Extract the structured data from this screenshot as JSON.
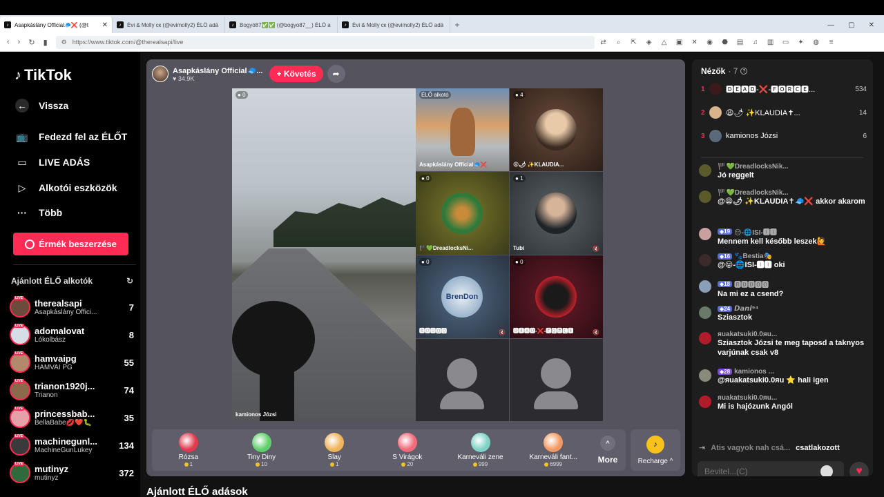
{
  "browser": {
    "tabs": [
      {
        "title": "Asapkáslány Official🧢❌ (@t"
      },
      {
        "title": "Évi & Molly ск (@evimolly2) ÉLŐ adá"
      },
      {
        "title": "Bogyó87✅✅ (@bogyo87__) ÉLŐ a"
      },
      {
        "title": "Évi & Molly ск (@evimolly2) ÉLŐ adá"
      }
    ],
    "url": "https://www.tiktok.com/@therealsapi/live"
  },
  "sidebar": {
    "logo": "TikTok",
    "back": "Vissza",
    "nav": [
      "Fedezd fel az ÉLŐT",
      "LIVE ADÁS",
      "Alkotói eszközök",
      "Több"
    ],
    "coins_button": "Érmék beszerzése",
    "recommended_title": "Ajánlott ÉLŐ alkotók",
    "live_tag": "LIVE",
    "recommended": [
      {
        "name": "therealsapi",
        "sub": "Asapkáslány Offici...",
        "count": "7"
      },
      {
        "name": "adomalovat",
        "sub": "Lókolbász",
        "count": "8"
      },
      {
        "name": "hamvaipg",
        "sub": "HAMVAI PG",
        "count": "55"
      },
      {
        "name": "trianon1920j...",
        "sub": "Trianon",
        "count": "74"
      },
      {
        "name": "princessbab...",
        "sub": "BellaBabe💋❤️🐛",
        "count": "35"
      },
      {
        "name": "machinegunl...",
        "sub": "MachineGunLukey",
        "count": "134"
      },
      {
        "name": "mutinyz",
        "sub": "mutinyz",
        "count": "372"
      }
    ]
  },
  "stream": {
    "host_name": "Asapkáslány Official🧢...",
    "host_likes": "♥ 34.9K",
    "follow": "+ Követés",
    "main_viewers": "0",
    "main_label": "kamionos Józsi",
    "tiles": [
      {
        "badge": "ÉLŐ alkotó",
        "label": "Asapkáslány Official🧢❌"
      },
      {
        "badge": "4",
        "label": "😩🌶 ✨KLAUDIA..."
      },
      {
        "badge": "0",
        "label": "🏴💚DreadlocksNi..."
      },
      {
        "badge": "1",
        "label": "Tubi"
      },
      {
        "badge": "0",
        "label": "🅱🅳🅳🅾🅾"
      },
      {
        "badge": "0",
        "label": "🅳🅴🅰🅳-❌-🅵🅾🆁🅲🅴"
      }
    ],
    "brendon": "BrenDon",
    "gifts": [
      {
        "name": "Rózsa",
        "price": "1",
        "color": "#e23a4e"
      },
      {
        "name": "Tiny Diny",
        "price": "10",
        "color": "#5fd06b"
      },
      {
        "name": "Slay",
        "price": "1",
        "color": "#f0b45a"
      },
      {
        "name": "S Virágok",
        "price": "20",
        "color": "#f06a7a"
      },
      {
        "name": "Karneváli zene",
        "price": "999",
        "color": "#7ed3c6"
      },
      {
        "name": "Karneváli fant...",
        "price": "6999",
        "color": "#f39a64"
      }
    ],
    "more": "More",
    "recharge": "Recharge ^"
  },
  "bottom_title": "Ajánlott ÉLŐ adások",
  "chat": {
    "viewers_title": "Nézők",
    "viewers_count": "· 7",
    "top_viewers": [
      {
        "rank": "1",
        "name": "🅳🅴🅰🅳-❌-🅵🅾🆁🅲🅴...",
        "count": "534"
      },
      {
        "rank": "2",
        "name": "😩🌶 ✨KLAUDIA✝...",
        "count": "14"
      },
      {
        "rank": "3",
        "name": "kamionos Józsi",
        "count": "6"
      }
    ],
    "messages": [
      {
        "user": "🏴💚DreadlocksNik...",
        "level": "",
        "text": "Jó reggelt"
      },
      {
        "user": "🏴💚DreadlocksNik...",
        "level": "",
        "text": "@😩🌶 ✨KLAUDIA✝🧢❌ akkor akarom"
      },
      {
        "user": "😑-🌐ISI-🅸🅸",
        "level": "19",
        "text": "Mennem kell később leszek🙋"
      },
      {
        "user": "🐾Bestia🎭",
        "level": "16",
        "text": "@😛-🌐ISI-🅸🅸 oki"
      },
      {
        "user": "🅱🅳🅳🅾🅾",
        "level": "18",
        "text": "Na mi ez a csend?"
      },
      {
        "user": "𝘿𝙖𝙣𝙞⁹⁴",
        "level": "24",
        "text": "Sziasztok"
      },
      {
        "user": "ᴙuakatsuki0.0ᴙu...",
        "level": "",
        "text": "Sziasztok Józsi te meg taposd a taknyos varjúnak csak v8"
      },
      {
        "user": "kamionos ...",
        "level": "28",
        "text": "@ᴙuakatsuki0.0ᴙu ⭐ hali igen"
      },
      {
        "user": "ᴙuakatsuki0.0ᴙu...",
        "level": "",
        "text": "Mi is hajózunk Angól"
      }
    ],
    "joined_user": "Atis vagyok nah csá...",
    "joined_text": "csatlakozott",
    "input_placeholder": "Bevitel...(C)"
  }
}
